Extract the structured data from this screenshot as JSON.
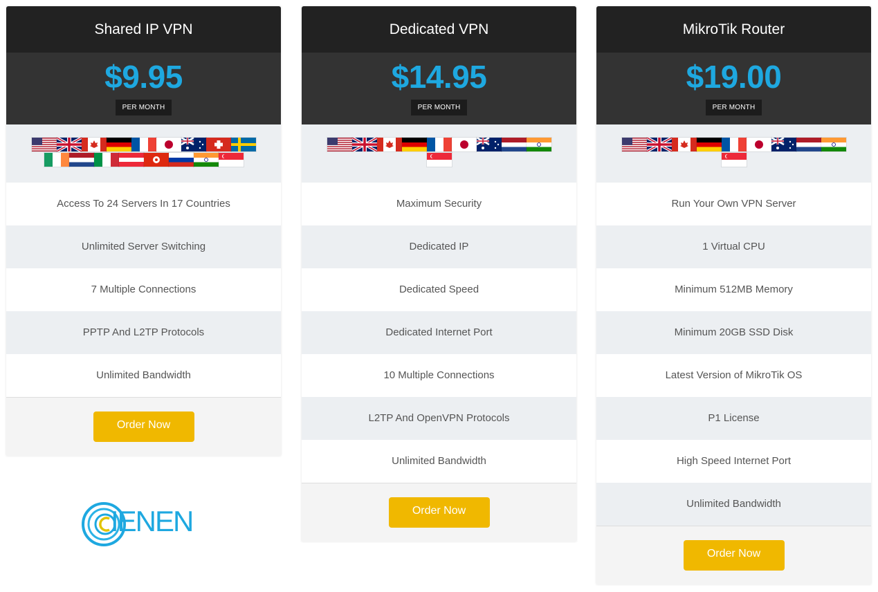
{
  "plans": [
    {
      "title": "Shared IP VPN",
      "price": "$9.95",
      "period": "PER MONTH",
      "flags": [
        "us",
        "gb",
        "ca",
        "de",
        "fr",
        "jp",
        "au",
        "ch",
        "se",
        "ie",
        "nl",
        "it",
        "at",
        "hk",
        "ru",
        "in",
        "sg"
      ],
      "features": [
        "Access To 24 Servers In 17 Countries",
        "Unlimited Server Switching",
        "7 Multiple Connections",
        "PPTP And L2TP Protocols",
        "Unlimited Bandwidth"
      ],
      "order_label": "Order Now"
    },
    {
      "title": "Dedicated VPN",
      "price": "$14.95",
      "period": "PER MONTH",
      "flags": [
        "us",
        "gb",
        "ca",
        "de",
        "fr",
        "jp",
        "au",
        "nl",
        "in",
        "sg"
      ],
      "features": [
        "Maximum Security",
        "Dedicated IP",
        "Dedicated Speed",
        "Dedicated Internet Port",
        "10 Multiple Connections",
        "L2TP And OpenVPN Protocols",
        "Unlimited Bandwidth"
      ],
      "order_label": "Order Now"
    },
    {
      "title": "MikroTik Router",
      "price": "$19.00",
      "period": "PER MONTH",
      "flags": [
        "us",
        "gb",
        "ca",
        "de",
        "fr",
        "jp",
        "au",
        "nl",
        "in",
        "sg"
      ],
      "features": [
        "Run Your Own VPN Server",
        "1 Virtual CPU",
        "Minimum 512MB Memory",
        "Minimum 20GB SSD Disk",
        "Latest Version of MikroTik OS",
        "P1 License",
        "High Speed Internet Port",
        "Unlimited Bandwidth"
      ],
      "order_label": "Order Now"
    }
  ],
  "logo": {
    "text": "IENEN"
  },
  "colors": {
    "accent": "#1ea8e0",
    "button": "#f0b800",
    "header": "#222222",
    "price_band": "#333333"
  }
}
